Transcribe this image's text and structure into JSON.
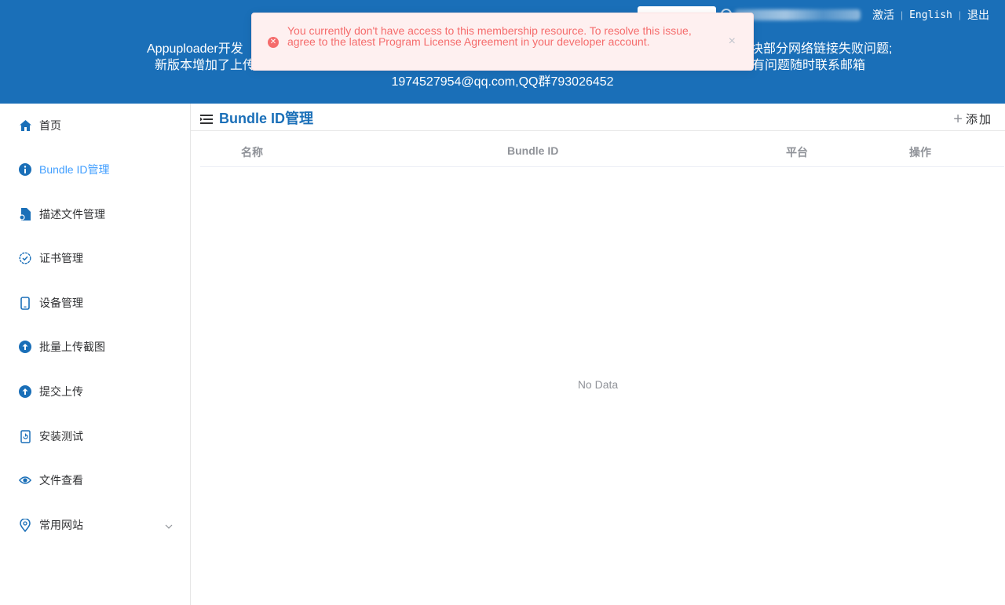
{
  "header": {
    "activate_label": "激活",
    "language_label": "English",
    "logout_label": "退出",
    "announcement_line1": "Appuploader开发",
    "announcement_line1_tail": "块部分网络链接失败问题;",
    "announcement_line2": "新版本增加了上传",
    "announcement_line2_tail": "有问题随时联系邮箱",
    "announcement_line3": "1974527954@qq.com,QQ群793026452"
  },
  "toast": {
    "message": "You currently don't have access to this membership resource. To resolve this issue, agree to the latest Program License Agreement in your developer account.",
    "close_glyph": "×"
  },
  "sidebar": {
    "items": [
      {
        "label": "首页",
        "icon": "home-icon"
      },
      {
        "label": "Bundle ID管理",
        "icon": "info-circle-icon"
      },
      {
        "label": "描述文件管理",
        "icon": "document-icon"
      },
      {
        "label": "证书管理",
        "icon": "certificate-check-icon"
      },
      {
        "label": "设备管理",
        "icon": "phone-icon"
      },
      {
        "label": "批量上传截图",
        "icon": "upload-circle-icon"
      },
      {
        "label": "提交上传",
        "icon": "upload-circle-icon"
      },
      {
        "label": "安装测试",
        "icon": "install-icon"
      },
      {
        "label": "文件查看",
        "icon": "eye-icon"
      },
      {
        "label": "常用网站",
        "icon": "location-icon"
      }
    ],
    "active_index": 1
  },
  "main": {
    "title": "Bundle ID管理",
    "add_label": "添加",
    "columns": [
      "名称",
      "Bundle ID",
      "平台",
      "操作"
    ],
    "empty_text": "No Data"
  },
  "colors": {
    "header_bg": "#1a6fb8",
    "active": "#409eff",
    "error": "#f56c6c"
  }
}
